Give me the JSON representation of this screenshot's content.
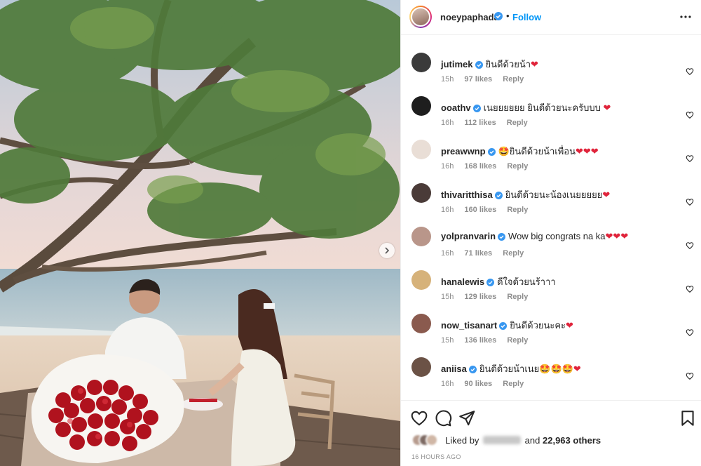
{
  "post": {
    "username": "noeypaphada",
    "follow_label": "Follow",
    "separator": "•",
    "more_icon": "more-horizontal-icon"
  },
  "comments": [
    {
      "user": "jutimek",
      "text": "ยินดีด้วยน้า",
      "emoji": "❤",
      "time": "15h",
      "likes": "97 likes",
      "reply": "Reply",
      "avatar_color": "#3b3b3b"
    },
    {
      "user": "ooathv",
      "text": "เนยยยยยย ยินดีด้วยนะครับบบ ",
      "emoji": "❤",
      "time": "16h",
      "likes": "112 likes",
      "reply": "Reply",
      "avatar_color": "#1e1e1e"
    },
    {
      "user": "preawwnp",
      "text": "ยินดีด้วยน้าเพื่อน",
      "lead_emoji": "🤩",
      "emoji": "❤❤❤",
      "time": "16h",
      "likes": "168 likes",
      "reply": "Reply",
      "avatar_color": "#e9ded6"
    },
    {
      "user": "thivaritthisa",
      "text": "ยินดีด้วยนะน้องเนยยยยย",
      "emoji": "❤",
      "time": "16h",
      "likes": "160 likes",
      "reply": "Reply",
      "avatar_color": "#4a3b38"
    },
    {
      "user": "yolpranvarin",
      "text": "Wow big congrats na ka",
      "emoji": "❤❤❤",
      "time": "16h",
      "likes": "71 likes",
      "reply": "Reply",
      "avatar_color": "#b9968a"
    },
    {
      "user": "hanalewis",
      "text": "ดีใจด้วยนร้าาา",
      "emoji": "",
      "time": "15h",
      "likes": "129 likes",
      "reply": "Reply",
      "avatar_color": "#d6b27a"
    },
    {
      "user": "now_tisanart",
      "text": "ยินดีด้วยนะคะ",
      "emoji": "❤",
      "time": "15h",
      "likes": "136 likes",
      "reply": "Reply",
      "avatar_color": "#8a5a4e"
    },
    {
      "user": "aniisa",
      "text": "ยินดีด้วยน้าเนย",
      "emoji": "🤩🤩🤩❤",
      "time": "16h",
      "likes": "90 likes",
      "reply": "Reply",
      "avatar_color": "#6b5246"
    }
  ],
  "actions": {
    "like_icon": "heart-icon",
    "comment_icon": "comment-icon",
    "share_icon": "send-icon",
    "save_icon": "bookmark-icon"
  },
  "likes": {
    "prefix": "Liked by",
    "connector": "and",
    "others": "22,963 others"
  },
  "timestamp": "16 HOURS AGO"
}
